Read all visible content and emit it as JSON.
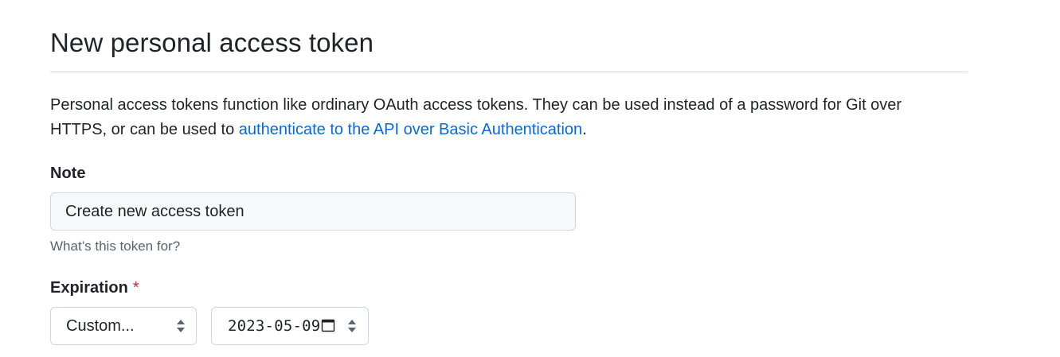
{
  "header": {
    "title": "New personal access token"
  },
  "description": {
    "text_before": "Personal access tokens function like ordinary OAuth access tokens. They can be used instead of a password for Git over HTTPS, or can be used to ",
    "link_text": "authenticate to the API over Basic Authentication",
    "text_after": "."
  },
  "note": {
    "label": "Note",
    "value": "Create new access token",
    "hint": "What’s this token for?"
  },
  "expiration": {
    "label": "Expiration",
    "required_marker": "*",
    "selected_option": "Custom...",
    "date_value": "2023-05-09"
  },
  "colors": {
    "link": "#0969da",
    "required": "#cf222e",
    "border": "#d0d7de",
    "input_background": "#f6f8fa"
  },
  "icons": {
    "select_arrows": "chevron-updown-icon",
    "date_picker": "calendar-icon"
  }
}
